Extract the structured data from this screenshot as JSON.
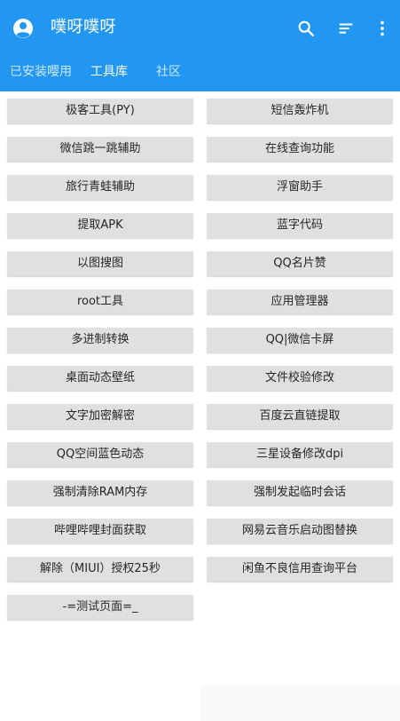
{
  "app": {
    "title": "噗呀噗呀",
    "accent_color": "#2196f3",
    "icons": {
      "app": "account-circle-icon",
      "search": "search-icon",
      "sort": "sort-icon",
      "more": "more-vert-icon"
    }
  },
  "tabs": [
    {
      "label": "已安装嘤用",
      "active": false
    },
    {
      "label": "工具库",
      "active": true
    },
    {
      "label": "社区",
      "active": false
    }
  ],
  "tools": [
    "极客工具(PY)",
    "短信轰炸机",
    "微信跳一跳辅助",
    "在线查询功能",
    "旅行青蛙辅助",
    "浮窗助手",
    "提取APK",
    "蓝字代码",
    "以图搜图",
    "QQ名片赞",
    "root工具",
    "应用管理器",
    "多进制转换",
    "QQ|微信卡屏",
    "桌面动态壁纸",
    "文件校验修改",
    "文字加密解密",
    "百度云直链提取",
    "QQ空间蓝色动态",
    "三星设备修改dpi",
    "强制清除RAM内存",
    "强制发起临时会话",
    "哔哩哔哩封面获取",
    "网易云音乐启动图替换",
    "解除（MIUI）授权25秒",
    "闲鱼不良信用查询平台",
    "-=测试页面=_"
  ]
}
